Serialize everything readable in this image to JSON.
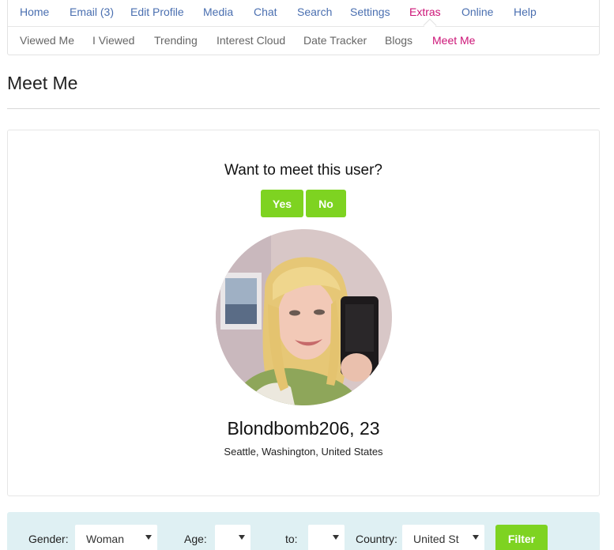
{
  "nav": {
    "primary": [
      {
        "label": "Home",
        "active": false
      },
      {
        "label": "Email (3)",
        "active": false
      },
      {
        "label": "Edit Profile",
        "active": false
      },
      {
        "label": "Media",
        "active": false
      },
      {
        "label": "Chat",
        "active": false
      },
      {
        "label": "Search",
        "active": false
      },
      {
        "label": "Settings",
        "active": false
      },
      {
        "label": "Extras",
        "active": true
      },
      {
        "label": "Online",
        "active": false
      },
      {
        "label": "Help",
        "active": false
      }
    ],
    "secondary": [
      {
        "label": "Viewed Me",
        "active": false
      },
      {
        "label": "I Viewed",
        "active": false
      },
      {
        "label": "Trending",
        "active": false
      },
      {
        "label": "Interest Cloud",
        "active": false
      },
      {
        "label": "Date Tracker",
        "active": false
      },
      {
        "label": "Blogs",
        "active": false
      },
      {
        "label": "Meet Me",
        "active": true
      }
    ]
  },
  "page": {
    "title": "Meet Me"
  },
  "meet": {
    "question": "Want to meet this user?",
    "yes_label": "Yes",
    "no_label": "No",
    "profile_name": "Blondbomb206, 23",
    "profile_location": "Seattle, Washington, United States"
  },
  "filter": {
    "gender_label": "Gender:",
    "gender_value": "Woman",
    "age_label": "Age:",
    "age_from_value": "",
    "to_label": "to:",
    "age_to_value": "",
    "country_label": "Country:",
    "country_value": "United St",
    "button_label": "Filter"
  },
  "colors": {
    "link_blue": "#4a6fb0",
    "active_magenta": "#cc1477",
    "button_green": "#7ed321",
    "filter_bg": "#dff0f3"
  }
}
